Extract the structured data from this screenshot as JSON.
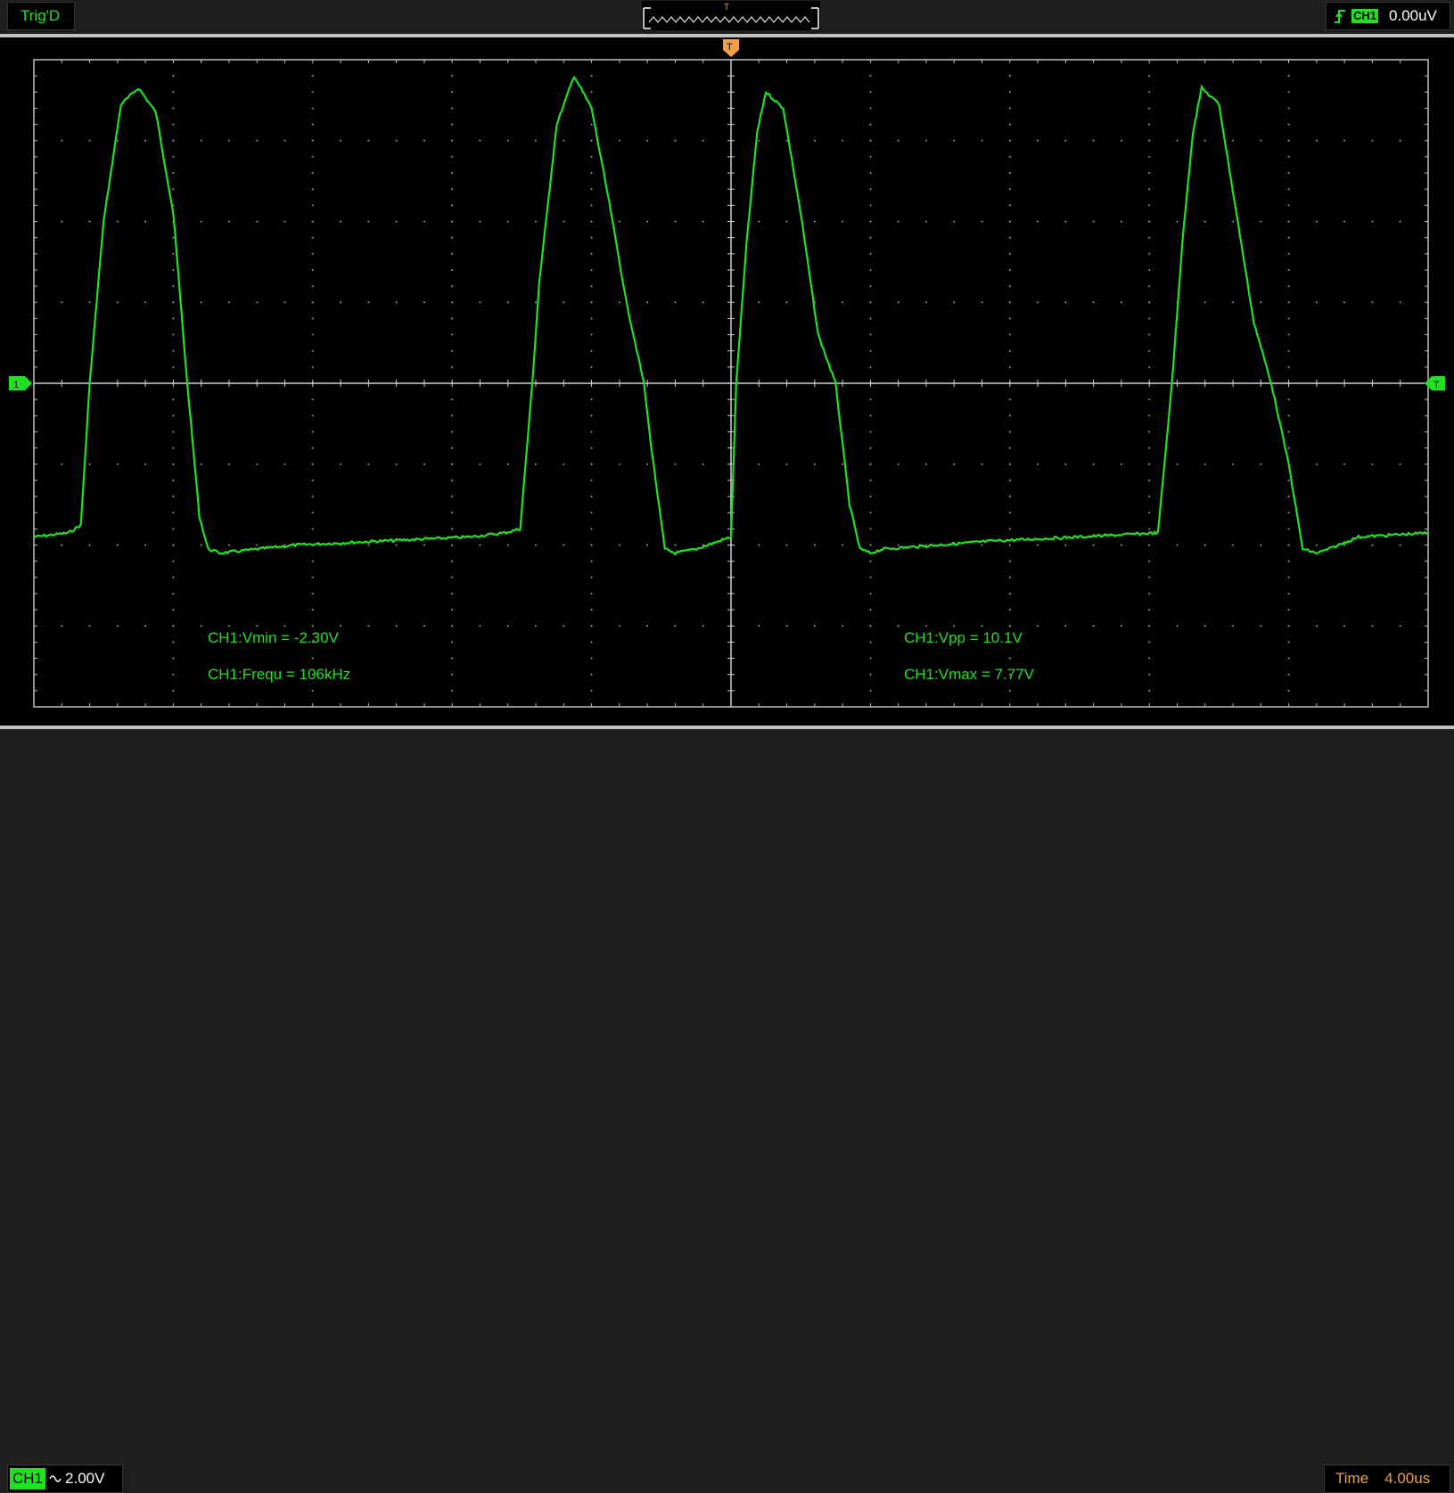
{
  "header": {
    "trigger_status": "Trig'D",
    "preview_trigger_mark": "T",
    "trigger_source": "CH1",
    "trigger_level": "0.00uV",
    "trigger_edge": "rising-edge-icon"
  },
  "screen": {
    "trigger_pos_marker": "T",
    "channel_marker": "1",
    "trigger_level_marker": "T",
    "measurements": {
      "vmin": "CH1:Vmin = -2.30V",
      "frequ": "CH1:Frequ = 106kHz",
      "vpp": "CH1:Vpp = 10.1V",
      "vmax": "CH1:Vmax = 7.77V"
    }
  },
  "footer": {
    "channel": "CH1",
    "coupling_icon": "ac-coupling-icon",
    "volts_per_div": "2.00V",
    "time_label": "Time",
    "time_per_div": "4.00us"
  },
  "chart_data": {
    "type": "line",
    "x_unit": "us",
    "y_unit": "V",
    "xlim": [
      -40,
      40
    ],
    "ylim": [
      -8,
      8
    ],
    "x_divisions": 10,
    "y_divisions": 8,
    "grid": true,
    "series": [
      {
        "name": "CH1",
        "color": "#21e021",
        "x": [
          -40,
          -38,
          -37.3,
          -36.8,
          -36,
          -35,
          -34,
          -33,
          -32,
          -31.2,
          -30.5,
          -30,
          -29.3,
          -25,
          -20,
          -15,
          -13,
          -12.1,
          -11.4,
          -11,
          -10,
          -9,
          -8,
          -7,
          -6,
          -5,
          -4.6,
          -3.8,
          -3.2,
          -2,
          0,
          0.3,
          0.9,
          1.5,
          2,
          3,
          4,
          5,
          6,
          6.8,
          7.4,
          8,
          8.7,
          15,
          20,
          24.5,
          25.3,
          25.9,
          26.5,
          27,
          28,
          29,
          30,
          31,
          32,
          32.8,
          33.6,
          34.3,
          36,
          40
        ],
        "y": [
          -3.8,
          -3.7,
          -3.5,
          0,
          4,
          6.9,
          7.3,
          6.7,
          4.2,
          0,
          -3.3,
          -4.1,
          -4.2,
          -4.0,
          -3.9,
          -3.8,
          -3.7,
          -3.6,
          0,
          2.5,
          6.4,
          7.6,
          6.8,
          4.5,
          2,
          0,
          -1.5,
          -4.1,
          -4.2,
          -4.1,
          -3.8,
          0,
          3.5,
          6.2,
          7.2,
          6.8,
          4.2,
          1.2,
          0,
          -3,
          -4.1,
          -4.2,
          -4.1,
          -3.9,
          -3.8,
          -3.7,
          0,
          3.5,
          6.2,
          7.3,
          6.9,
          4.2,
          1.5,
          0,
          -2,
          -4.1,
          -4.2,
          -4.1,
          -3.8,
          -3.7
        ]
      }
    ]
  }
}
